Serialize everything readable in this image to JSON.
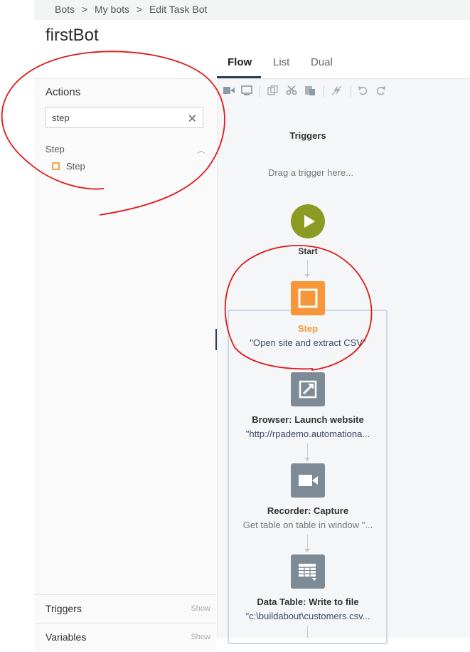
{
  "breadcrumb": {
    "items": [
      "Bots",
      ">",
      "My bots",
      ">",
      "Edit Task Bot"
    ]
  },
  "page_title": "firstBot",
  "actions": {
    "heading": "Actions",
    "search_value": "step",
    "category": "Step",
    "item": "Step"
  },
  "bottom": {
    "triggers_label": "Triggers",
    "triggers_show": "Show",
    "variables_label": "Variables",
    "variables_show": "Show"
  },
  "tabs": [
    "Flow",
    "List",
    "Dual"
  ],
  "flow": {
    "triggers_title": "Triggers",
    "drag_hint": "Drag a trigger here...",
    "start_label": "Start",
    "nodes": [
      {
        "title": "Step",
        "desc": "\"Open site and extract CSV\""
      },
      {
        "title": "Browser: Launch website",
        "desc": "\"http://rpademo.automationa..."
      },
      {
        "title": "Recorder: Capture",
        "desc": "Get table on table in window \"..."
      },
      {
        "title": "Data Table: Write to file",
        "desc": "\"c:\\buildabout\\customers.csv..."
      }
    ]
  },
  "colors": {
    "step_orange": "#f5973a",
    "node_gray": "#7d8b96",
    "start_green": "#8a9a22",
    "annotation_red": "#e01818"
  }
}
